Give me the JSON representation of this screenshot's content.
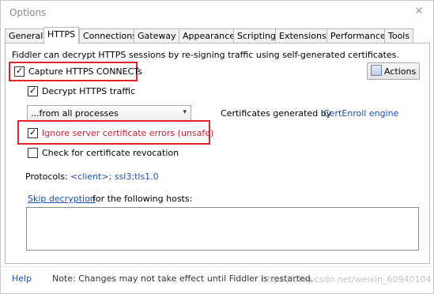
{
  "window": {
    "title": "Options"
  },
  "tabs": [
    {
      "label": "General",
      "active": false
    },
    {
      "label": "HTTPS",
      "active": true
    },
    {
      "label": "Connections",
      "active": false
    },
    {
      "label": "Gateway",
      "active": false
    },
    {
      "label": "Appearance",
      "active": false
    },
    {
      "label": "Scripting",
      "active": false
    },
    {
      "label": "Extensions",
      "active": false
    },
    {
      "label": "Performance",
      "active": false
    },
    {
      "label": "Tools",
      "active": false
    }
  ],
  "https": {
    "description": "Fiddler can decrypt HTTPS sessions by re-signing traffic using self-generated certificates.",
    "capture_label": "Capture HTTPS CONNECTs",
    "capture_checked": true,
    "actions_label": "Actions",
    "decrypt_label": "Decrypt HTTPS traffic",
    "decrypt_checked": true,
    "process_filter_value": "...from all processes",
    "cert_generated_prefix": "Certificates generated by",
    "cert_engine_link": "CertEnroll engine",
    "ignore_errors_label": "Ignore server certificate errors (unsafe)",
    "ignore_errors_checked": true,
    "revocation_label": "Check for certificate revocation",
    "revocation_checked": false,
    "protocols_prefix": "Protocols:",
    "protocols_value": "<client>; ssl3;tls1.0",
    "skip_link": "Skip decryption",
    "skip_suffix": "for the following hosts:",
    "skip_hosts_value": ""
  },
  "footer": {
    "help_label": "Help",
    "note": "Note: Changes may not take effect until Fiddler is restarted.",
    "watermark": "https://blog.csdn.net/weixin_60940104"
  },
  "colors": {
    "highlight_red": "#e0262b",
    "link_blue": "#1a4fb5",
    "warning_red": "#c8203a"
  }
}
